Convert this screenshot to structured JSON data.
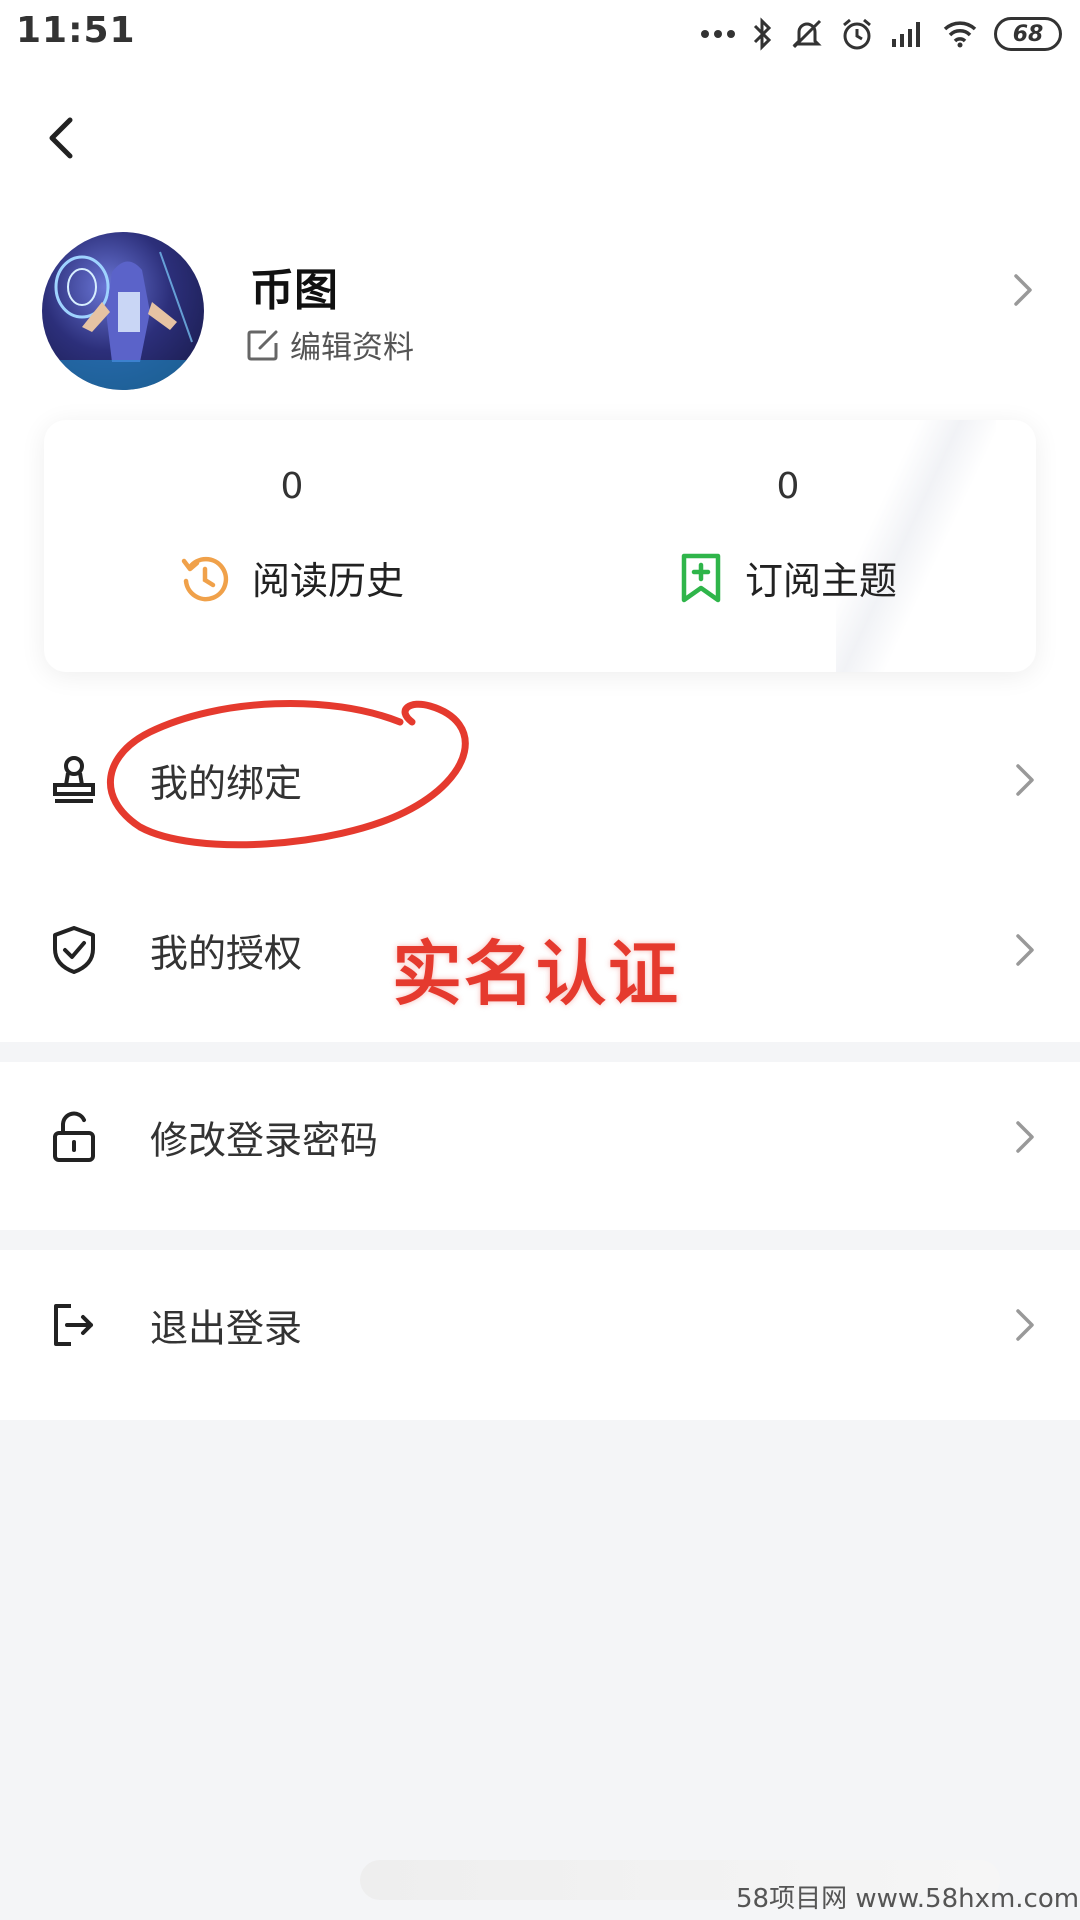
{
  "status_bar": {
    "time": "11:51",
    "battery": "68"
  },
  "profile": {
    "username": "币图",
    "edit_label": "编辑资料"
  },
  "stats": [
    {
      "count": "0",
      "label": "阅读历史",
      "icon": "history-icon",
      "icon_color": "#f0a14a"
    },
    {
      "count": "0",
      "label": "订阅主题",
      "icon": "bookmark-add-icon",
      "icon_color": "#2fb54a"
    }
  ],
  "menu": {
    "binding": "我的绑定",
    "authorization": "我的授权",
    "change_password": "修改登录密码",
    "logout": "退出登录"
  },
  "annotation": {
    "text": "实名认证",
    "color": "#e53a2e"
  },
  "watermark": "58项目网 www.58hxm.com"
}
